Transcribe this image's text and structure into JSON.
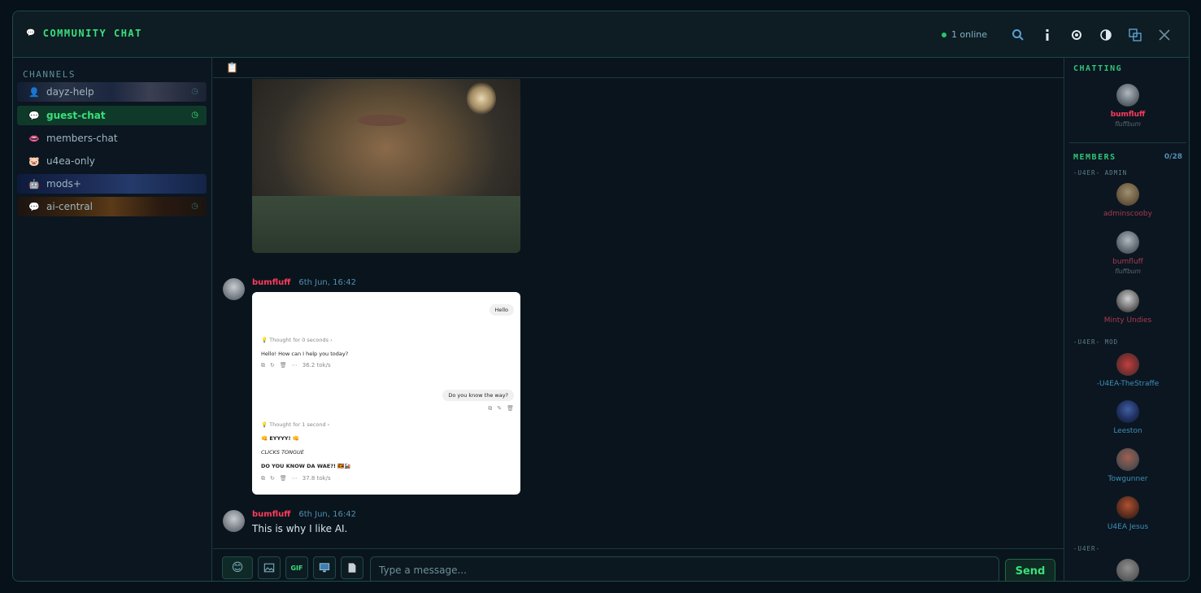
{
  "app": {
    "title": "COMMUNITY CHAT",
    "online_text": "1 online"
  },
  "sidebar": {
    "heading": "CHANNELS",
    "channels": [
      {
        "name": "dayz-help",
        "icon": "dayz-icon"
      },
      {
        "name": "guest-chat",
        "icon": "speech-bubble-icon",
        "active": true
      },
      {
        "name": "members-chat",
        "icon": "lips-icon"
      },
      {
        "name": "u4ea-only",
        "icon": "pig-icon"
      },
      {
        "name": "mods+",
        "icon": "robot-icon"
      },
      {
        "name": "ai-central",
        "icon": "speech-bubble-icon"
      }
    ]
  },
  "messages": [
    {
      "user": "bumfluff",
      "time": "6th Jun, 16:42",
      "type": "image"
    },
    {
      "user": "bumfluff",
      "time": "6th Jun, 16:42",
      "text": "This is why I like AI."
    }
  ],
  "screenshot": {
    "hello_pill": "Hello",
    "thought1": "Thought for 0 seconds",
    "reply1": "Hello! How can I help you today?",
    "speed1": "36.2 tok/s",
    "question_pill": "Do you know the way?",
    "thought2": "Thought for 1 second",
    "line1": "👊 EYYYY! 👊",
    "line2": "CLICKS TONGUE",
    "line3": "DO YOU KNOW DA WAE?! 🇺🇬🚂",
    "speed2": "37.8 tok/s"
  },
  "composer": {
    "placeholder": "Type a message...",
    "gif_label": "GIF",
    "send_label": "Send"
  },
  "right_panel": {
    "chatting_heading": "CHATTING",
    "chatting": {
      "name": "bumfluff",
      "sub": "fluffbum"
    },
    "members_heading": "MEMBERS",
    "members_count": "0/28",
    "roles": [
      {
        "name": "-U4ER- ADMIN",
        "members": [
          {
            "name": "adminscooby"
          },
          {
            "name": "bumfluff",
            "sub": "fluffbum"
          },
          {
            "name": "Minty Undies"
          }
        ]
      },
      {
        "name": "-U4ER- MOD",
        "members": [
          {
            "name": "-U4EA-TheStraffe"
          },
          {
            "name": "Leeston"
          },
          {
            "name": "Towgunner"
          },
          {
            "name": "U4EA Jesus"
          }
        ]
      },
      {
        "name": "-U4ER-",
        "members": []
      }
    ]
  },
  "colors": {
    "accent_green": "#39e07a",
    "user_red": "#ff3b5c",
    "time_blue": "#4f8fb0",
    "background": "#0a141d"
  }
}
